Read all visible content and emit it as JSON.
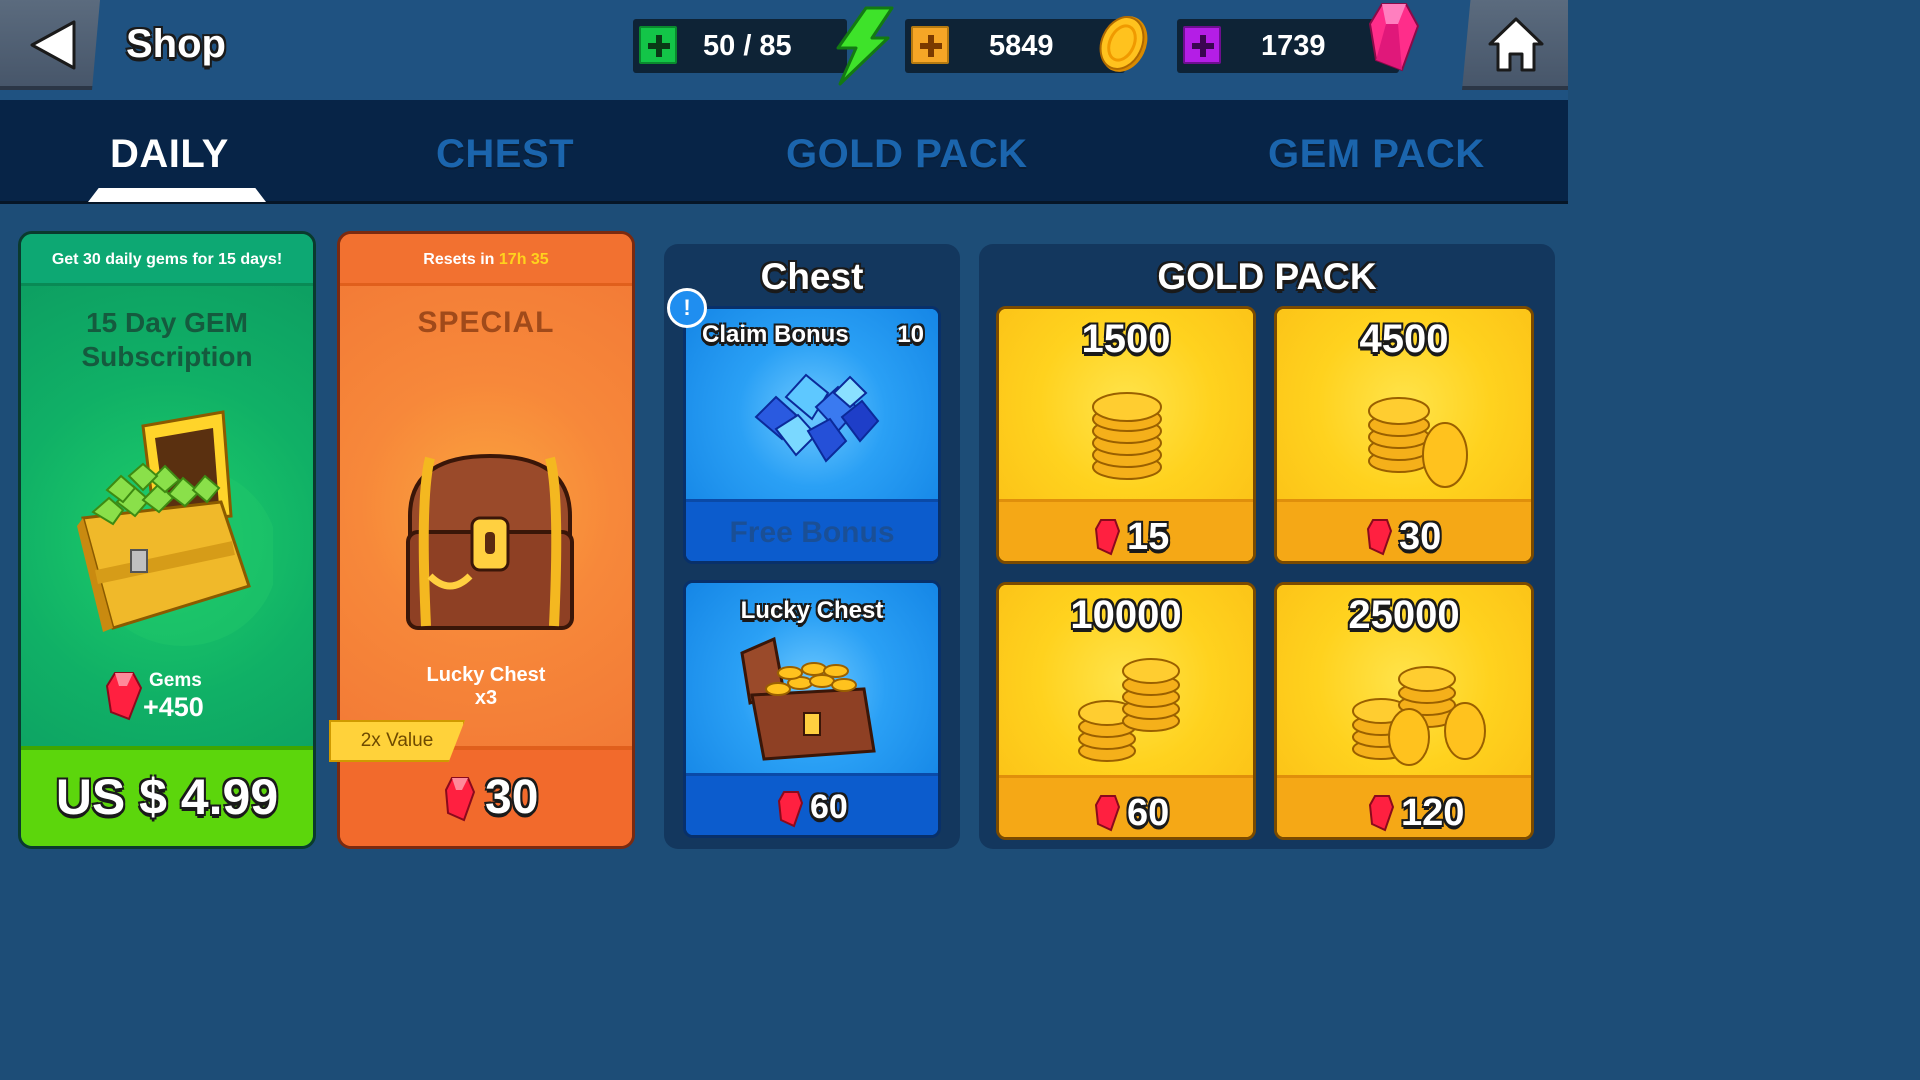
{
  "header": {
    "title": "Shop",
    "energy": "50 / 85",
    "gold": "5849",
    "gems": "1739"
  },
  "tabs": [
    {
      "label": "DAILY",
      "active": true
    },
    {
      "label": "CHEST",
      "active": false
    },
    {
      "label": "GOLD PACK",
      "active": false
    },
    {
      "label": "GEM PACK",
      "active": false
    }
  ],
  "subscription": {
    "banner": "Get 30 daily gems for 15 days!",
    "title_line1": "15 Day GEM",
    "title_line2": "Subscription",
    "reward_label": "Gems",
    "reward_amount": "+450",
    "price": "US $ 4.99"
  },
  "special": {
    "banner_prefix": "Resets in",
    "banner_time": "17h 35",
    "title": "SPECIAL",
    "item_line1": "Lucky Chest",
    "item_line2": "x3",
    "value_tag": "2x Value",
    "price": "30"
  },
  "chest_panel": {
    "title": "Chest",
    "badge": "!",
    "claim": {
      "label": "Claim Bonus",
      "count": "10",
      "footer": "Free Bonus"
    },
    "lucky": {
      "label": "Lucky Chest",
      "price": "60"
    }
  },
  "gold_panel": {
    "title": "GOLD PACK",
    "packs": [
      {
        "amount": "1500",
        "cost": "15"
      },
      {
        "amount": "4500",
        "cost": "30"
      },
      {
        "amount": "10000",
        "cost": "60"
      },
      {
        "amount": "25000",
        "cost": "120"
      }
    ]
  },
  "colors": {
    "background": "#1d4d77",
    "tab_active": "#ffffff",
    "tab_inactive": "#1b65ad",
    "subscription_green": "#0eb26a",
    "special_orange": "#f37a2f",
    "chest_blue": "#1586e6",
    "gold_yellow": "#ffcd1c",
    "energy_plus": "#13c548",
    "gold_plus": "#f5a626",
    "gem_plus": "#b41ee6"
  },
  "icons": {
    "back": "back-arrow-icon",
    "home": "home-icon",
    "energy": "lightning-icon",
    "gold": "coin-icon",
    "gem": "gem-icon"
  }
}
